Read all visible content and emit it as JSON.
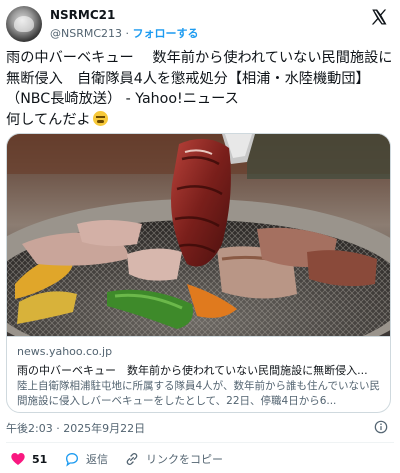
{
  "author": {
    "display_name": "NSRMC21",
    "handle": "@NSRMC213",
    "separator": "·",
    "follow_label": "フォローする"
  },
  "tweet": {
    "text": "雨の中バーベキュー　 数年前から使われていない民間施設に無断侵入　自衛隊員4人を懲戒処分【相浦・水陸機動団】（NBC長崎放送） - Yahoo!ニュース\n何してんだよ"
  },
  "card": {
    "domain": "news.yahoo.co.jp",
    "title": "雨の中バーベキュー　数年前から使われていない民間施設に無断侵入...",
    "description": "陸上自衛隊相浦駐屯地に所属する隊員4人が、数年前から誰も住んでいない民間施設に侵入しバーベキューをしたとして、22日、停職4日から6..."
  },
  "meta": {
    "timestamp": "午後2:03 · 2025年9月22日"
  },
  "actions": {
    "like_count": "51",
    "reply_label": "返信",
    "copy_link_label": "リンクをコピー"
  },
  "colors": {
    "accent": "#1d9bf0",
    "like": "#f91880",
    "text": "#0f1419",
    "secondary": "#536471"
  }
}
